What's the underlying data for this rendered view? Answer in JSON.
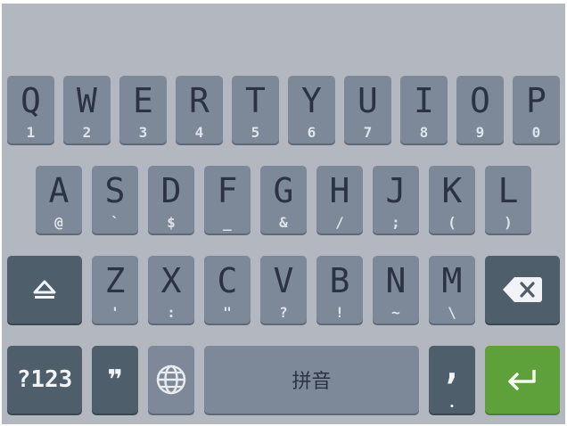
{
  "keyboard": {
    "row1": [
      {
        "main": "Q",
        "sub": "1"
      },
      {
        "main": "W",
        "sub": "2"
      },
      {
        "main": "E",
        "sub": "3"
      },
      {
        "main": "R",
        "sub": "4"
      },
      {
        "main": "T",
        "sub": "5"
      },
      {
        "main": "Y",
        "sub": "6"
      },
      {
        "main": "U",
        "sub": "7"
      },
      {
        "main": "I",
        "sub": "8"
      },
      {
        "main": "O",
        "sub": "9"
      },
      {
        "main": "P",
        "sub": "0"
      }
    ],
    "row2": [
      {
        "main": "A",
        "sub": "@"
      },
      {
        "main": "S",
        "sub": "`"
      },
      {
        "main": "D",
        "sub": "$"
      },
      {
        "main": "F",
        "sub": "_"
      },
      {
        "main": "G",
        "sub": "&"
      },
      {
        "main": "H",
        "sub": "/"
      },
      {
        "main": "J",
        "sub": ";"
      },
      {
        "main": "K",
        "sub": "("
      },
      {
        "main": "L",
        "sub": ")"
      }
    ],
    "row3": [
      {
        "main": "Z",
        "sub": "'"
      },
      {
        "main": "X",
        "sub": ":"
      },
      {
        "main": "C",
        "sub": "\""
      },
      {
        "main": "V",
        "sub": "?"
      },
      {
        "main": "B",
        "sub": "!"
      },
      {
        "main": "N",
        "sub": "~"
      },
      {
        "main": "M",
        "sub": "\\"
      }
    ],
    "row4": {
      "symbols_label": "?123",
      "quote_label": "❞",
      "space_label": "拼音",
      "comma_main": ",",
      "comma_sub": "."
    },
    "icons": {
      "shift": "shift-icon",
      "backspace": "backspace-icon",
      "globe": "globe-icon",
      "enter": "enter-icon"
    },
    "colors": {
      "background": "#b2b7c0",
      "letter_key": "#7d8899",
      "function_key": "#4e5e6b",
      "enter_key": "#5ea03a"
    }
  }
}
